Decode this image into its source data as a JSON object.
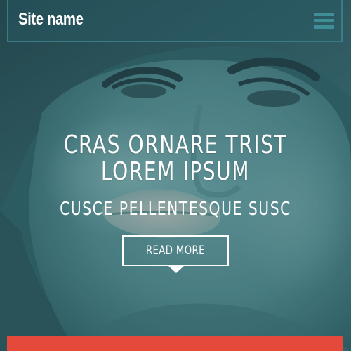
{
  "header": {
    "site_name": "Site name",
    "menu_icon": "hamburger-menu-icon"
  },
  "hero": {
    "title": "CRAS ORNARE TRIST LOREM IPSUM",
    "subtitle": "CUSCE PELLENTESQUE SUSC",
    "cta_label": "READ MORE",
    "background": "teal-tinted close-up portrait photo"
  },
  "colors": {
    "accent": "#e4493b",
    "overlay": "#2f5f66",
    "header_border": "#3c828c",
    "menu_icon": "#3f8d97",
    "text": "#ffffff"
  }
}
